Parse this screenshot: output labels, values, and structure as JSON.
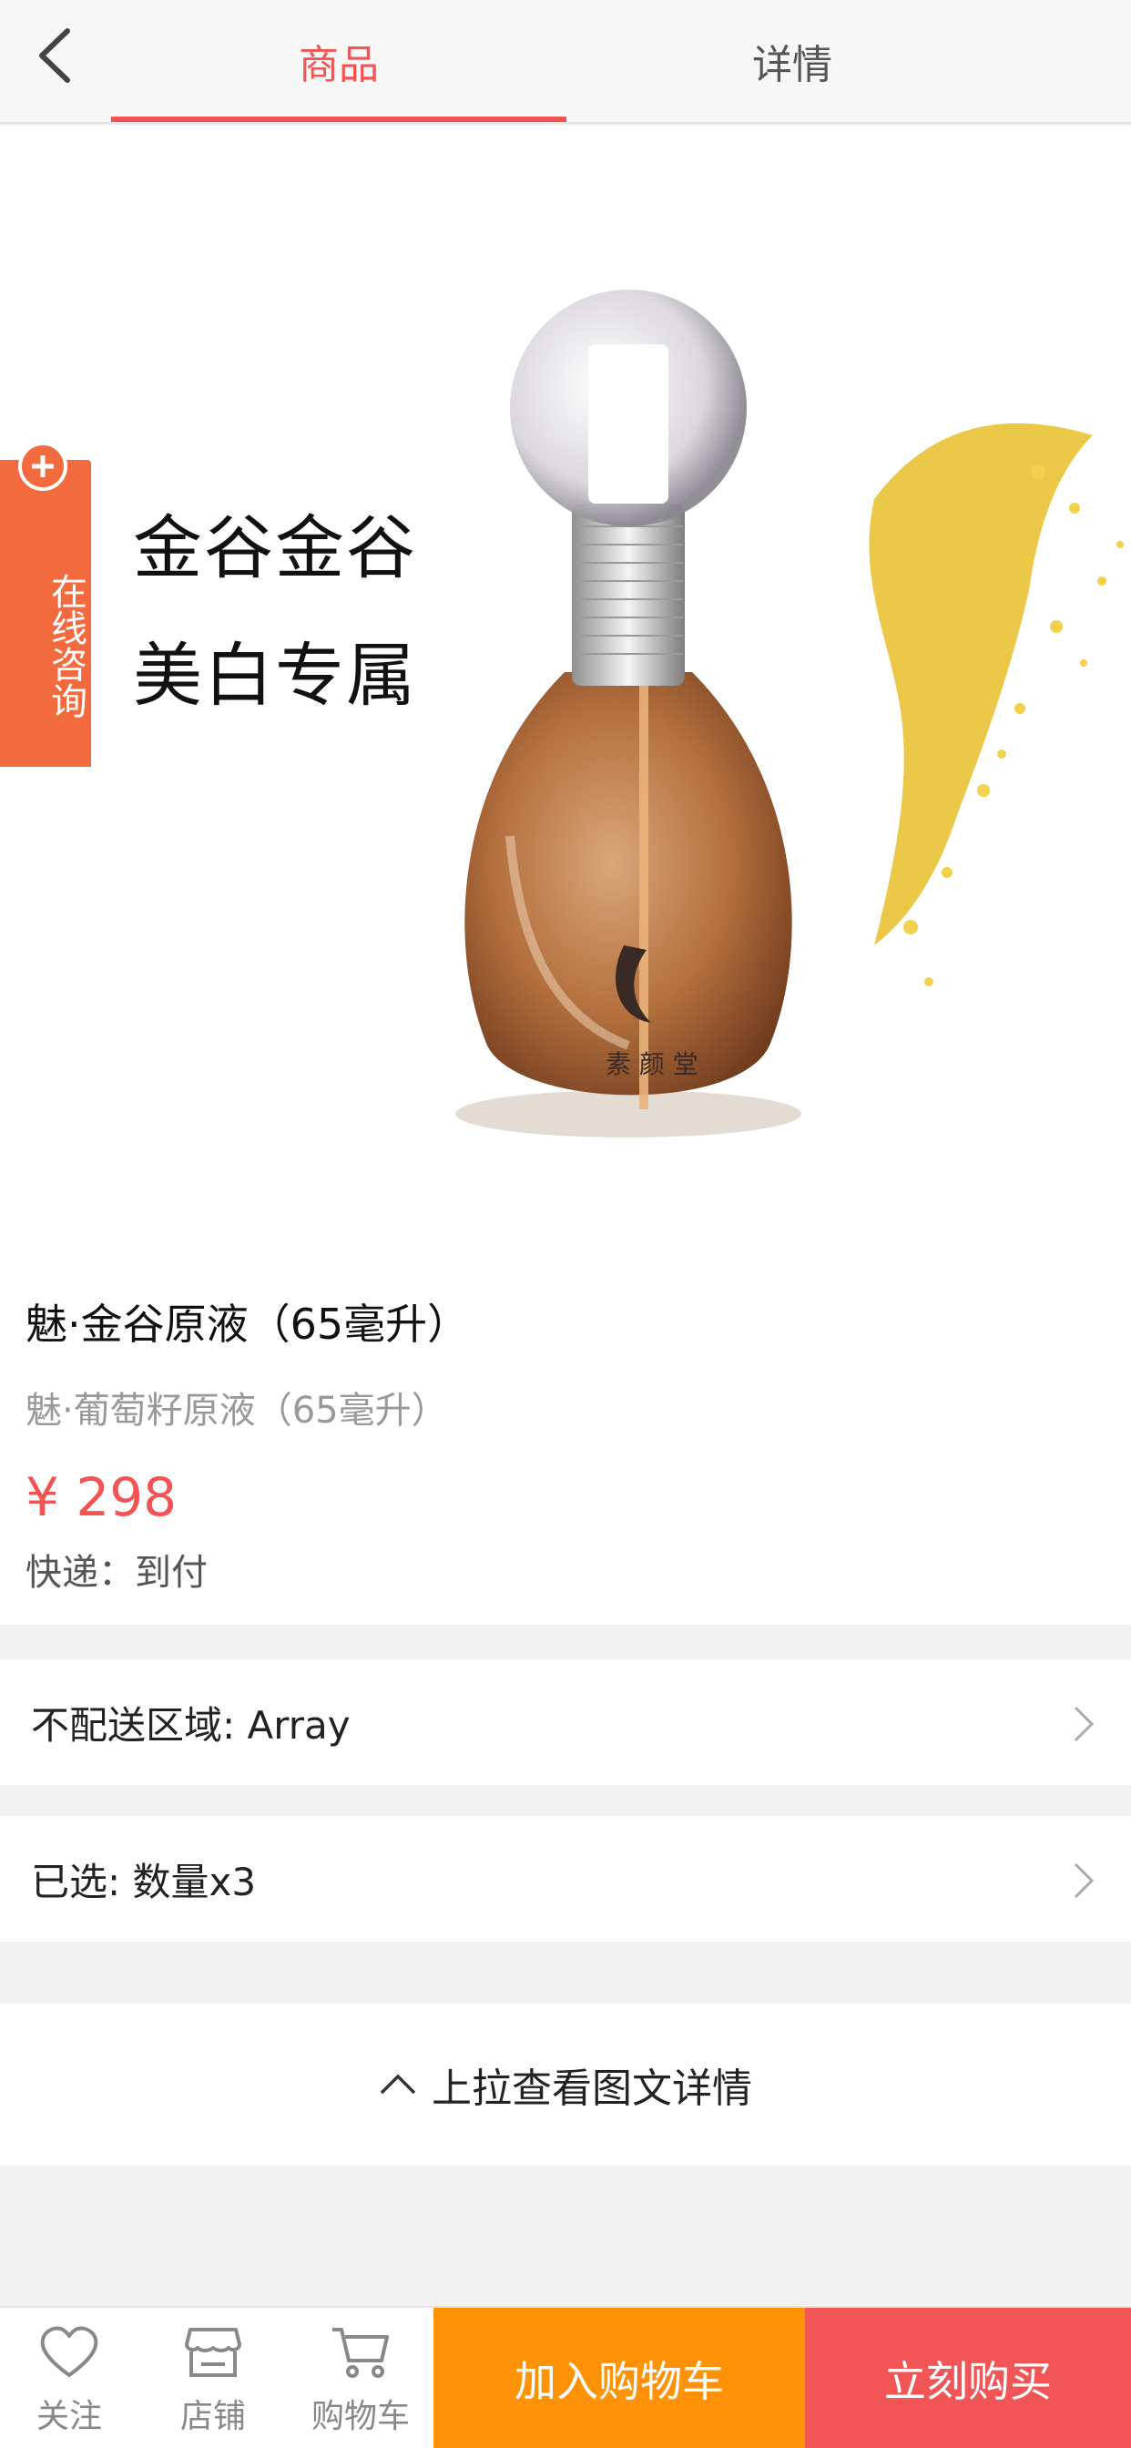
{
  "header": {
    "tabs": [
      {
        "label": "商品",
        "active": true
      },
      {
        "label": "详情",
        "active": false
      }
    ],
    "accent_color": "#f25454"
  },
  "hero": {
    "caption_line1": "金谷金谷",
    "caption_line2": "美白专属",
    "consult_label": "在线咨询",
    "consult_color": "#f26a3d"
  },
  "product": {
    "title": "魅·金谷原液（65毫升）",
    "subtitle": "魅·葡萄籽原液（65毫升）",
    "price": "¥ 298",
    "shipping": "快递：到付"
  },
  "rows": {
    "region": "不配送区域: Array",
    "selected": "已选: 数量x3"
  },
  "pullup": {
    "label": "上拉查看图文详情"
  },
  "bottombar": {
    "follow": "关注",
    "shop": "店铺",
    "cart": "购物车",
    "add_to_cart": "加入购物车",
    "buy_now": "立刻购买",
    "add_color": "#ff9305",
    "buy_color": "#f25555"
  }
}
